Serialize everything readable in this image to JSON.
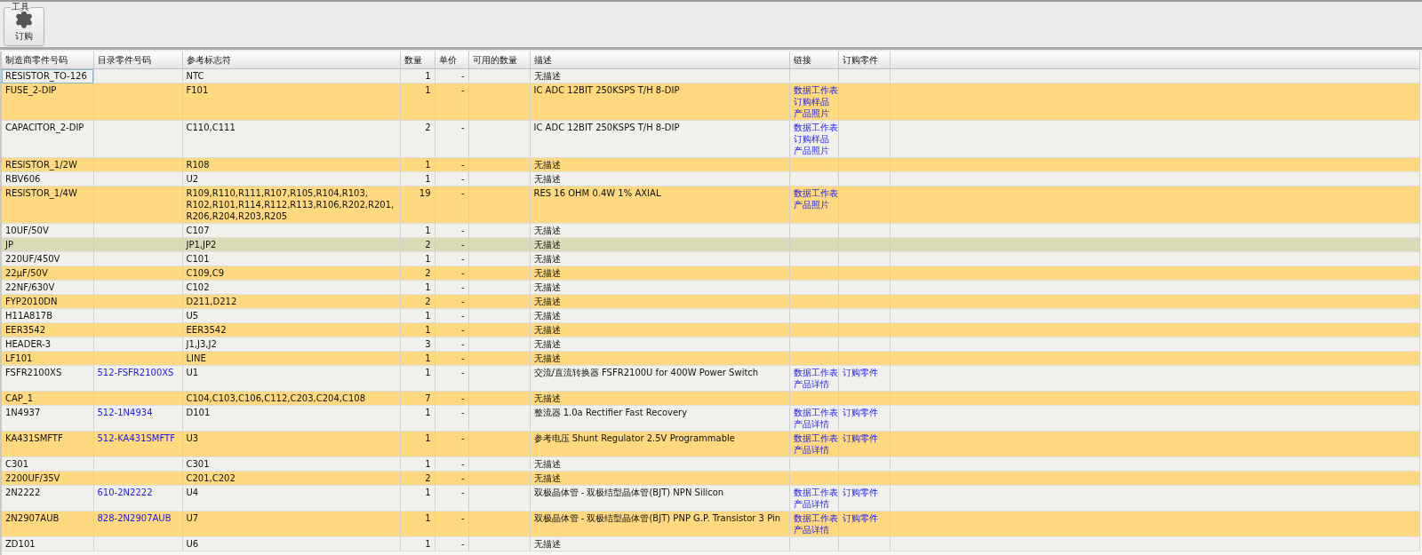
{
  "toolbar": {
    "group_label": "工具",
    "button": "订购"
  },
  "table": {
    "columns": [
      "制造商零件号码",
      "目录零件号码",
      "参考标志符",
      "数量",
      "单价",
      "可用的数量",
      "描述",
      "链接",
      "订购零件"
    ],
    "rows": [
      {
        "mpn": "RESISTOR_TO-126",
        "refdes": "NTC",
        "qty": "1",
        "price": "-",
        "description": "无描述",
        "selected": false,
        "focused": true
      },
      {
        "mpn": "FUSE_2-DIP",
        "refdes": "F101",
        "qty": "1",
        "price": "-",
        "description": "IC ADC 12BIT 250KSPS T/H 8-DIP",
        "links": [
          "数据工作表",
          "订购样品",
          "产品照片"
        ],
        "selected": false,
        "focused": false
      },
      {
        "mpn": "CAPACITOR_2-DIP",
        "refdes": "C110,C111",
        "qty": "2",
        "price": "-",
        "description": "IC ADC 12BIT 250KSPS T/H 8-DIP",
        "links": [
          "数据工作表",
          "订购样品",
          "产品照片"
        ],
        "selected": false,
        "focused": false
      },
      {
        "mpn": "RESISTOR_1/2W",
        "refdes": "R108",
        "qty": "1",
        "price": "-",
        "description": "无描述",
        "selected": false,
        "focused": false
      },
      {
        "mpn": "RBV606",
        "refdes": "U2",
        "qty": "1",
        "price": "-",
        "description": "无描述",
        "selected": false,
        "focused": false
      },
      {
        "mpn": "RESISTOR_1/4W",
        "refdes": "R109,R110,R111,R107,R105,R104,R103, R102,R101,R114,R112,R113,R106,R202,R201, R206,R204,R203,R205",
        "qty": "19",
        "price": "-",
        "description": "RES 16 OHM 0.4W 1% AXIAL",
        "links": [
          "数据工作表",
          "产品照片"
        ],
        "selected": false,
        "focused": false
      },
      {
        "mpn": "10UF/50V",
        "refdes": "C107",
        "qty": "1",
        "price": "-",
        "description": "无描述",
        "selected": false,
        "focused": false
      },
      {
        "mpn": "JP",
        "refdes": "JP1,JP2",
        "qty": "2",
        "price": "-",
        "description": "无描述",
        "selected": true,
        "focused": false
      },
      {
        "mpn": "220UF/450V",
        "refdes": "C101",
        "qty": "1",
        "price": "-",
        "description": "无描述",
        "selected": false,
        "focused": false
      },
      {
        "mpn": "22µF/50V",
        "refdes": "C109,C9",
        "qty": "2",
        "price": "-",
        "description": "无描述",
        "selected": false,
        "focused": false
      },
      {
        "mpn": "22NF/630V",
        "refdes": "C102",
        "qty": "1",
        "price": "-",
        "description": "无描述",
        "selected": false,
        "focused": false
      },
      {
        "mpn": "FYP2010DN",
        "refdes": "D211,D212",
        "qty": "2",
        "price": "-",
        "description": "无描述",
        "selected": false,
        "focused": false
      },
      {
        "mpn": "H11A817B",
        "refdes": "U5",
        "qty": "1",
        "price": "-",
        "description": "无描述",
        "selected": false,
        "focused": false
      },
      {
        "mpn": "EER3542",
        "refdes": "EER3542",
        "qty": "1",
        "price": "-",
        "description": "无描述",
        "selected": false,
        "focused": false
      },
      {
        "mpn": "HEADER-3",
        "refdes": "J1,J3,J2",
        "qty": "3",
        "price": "-",
        "description": "无描述",
        "selected": false,
        "focused": false
      },
      {
        "mpn": "LF101",
        "refdes": "LINE",
        "qty": "1",
        "price": "-",
        "description": "无描述",
        "selected": false,
        "focused": false
      },
      {
        "mpn": "FSFR2100XS",
        "catalog": "512-FSFR2100XS",
        "refdes": "U1",
        "qty": "1",
        "price": "-",
        "description": "交流/直流转换器 FSFR2100U for 400W Power Switch",
        "links": [
          "数据工作表",
          "产品详情"
        ],
        "order": "订购零件",
        "selected": false,
        "focused": false
      },
      {
        "mpn": "CAP_1",
        "refdes": "C104,C103,C106,C112,C203,C204,C108",
        "qty": "7",
        "price": "-",
        "description": "无描述",
        "selected": false,
        "focused": false
      },
      {
        "mpn": "1N4937",
        "catalog": "512-1N4934",
        "refdes": "D101",
        "qty": "1",
        "price": "-",
        "description": "整流器 1.0a Rectifier Fast Recovery",
        "links": [
          "数据工作表",
          "产品详情"
        ],
        "order": "订购零件",
        "selected": false,
        "focused": false
      },
      {
        "mpn": "KA431SMFTF",
        "catalog": "512-KA431SMFTF",
        "refdes": "U3",
        "qty": "1",
        "price": "-",
        "description": "参考电压 Shunt Regulator 2.5V Programmable",
        "links": [
          "数据工作表",
          "产品详情"
        ],
        "order": "订购零件",
        "selected": false,
        "focused": false
      },
      {
        "mpn": "C301",
        "refdes": "C301",
        "qty": "1",
        "price": "-",
        "description": "无描述",
        "selected": false,
        "focused": false
      },
      {
        "mpn": "2200UF/35V",
        "refdes": "C201,C202",
        "qty": "2",
        "price": "-",
        "description": "无描述",
        "selected": false,
        "focused": false
      },
      {
        "mpn": "2N2222",
        "catalog": "610-2N2222",
        "refdes": "U4",
        "qty": "1",
        "price": "-",
        "description": "双极晶体管 - 双极结型晶体管(BJT) NPN Silicon",
        "links": [
          "数据工作表",
          "产品详情"
        ],
        "order": "订购零件",
        "selected": false,
        "focused": false
      },
      {
        "mpn": "2N2907AUB",
        "catalog": "828-2N2907AUB",
        "refdes": "U7",
        "qty": "1",
        "price": "-",
        "description": "双极晶体管 - 双极结型晶体管(BJT) PNP G.P. Transistor 3 Pin",
        "links": [
          "数据工作表",
          "产品详情"
        ],
        "order": "订购零件",
        "selected": false,
        "focused": false
      },
      {
        "mpn": "ZD101",
        "refdes": "U6",
        "qty": "1",
        "price": "-",
        "description": "无描述",
        "selected": false,
        "focused": false
      }
    ]
  }
}
